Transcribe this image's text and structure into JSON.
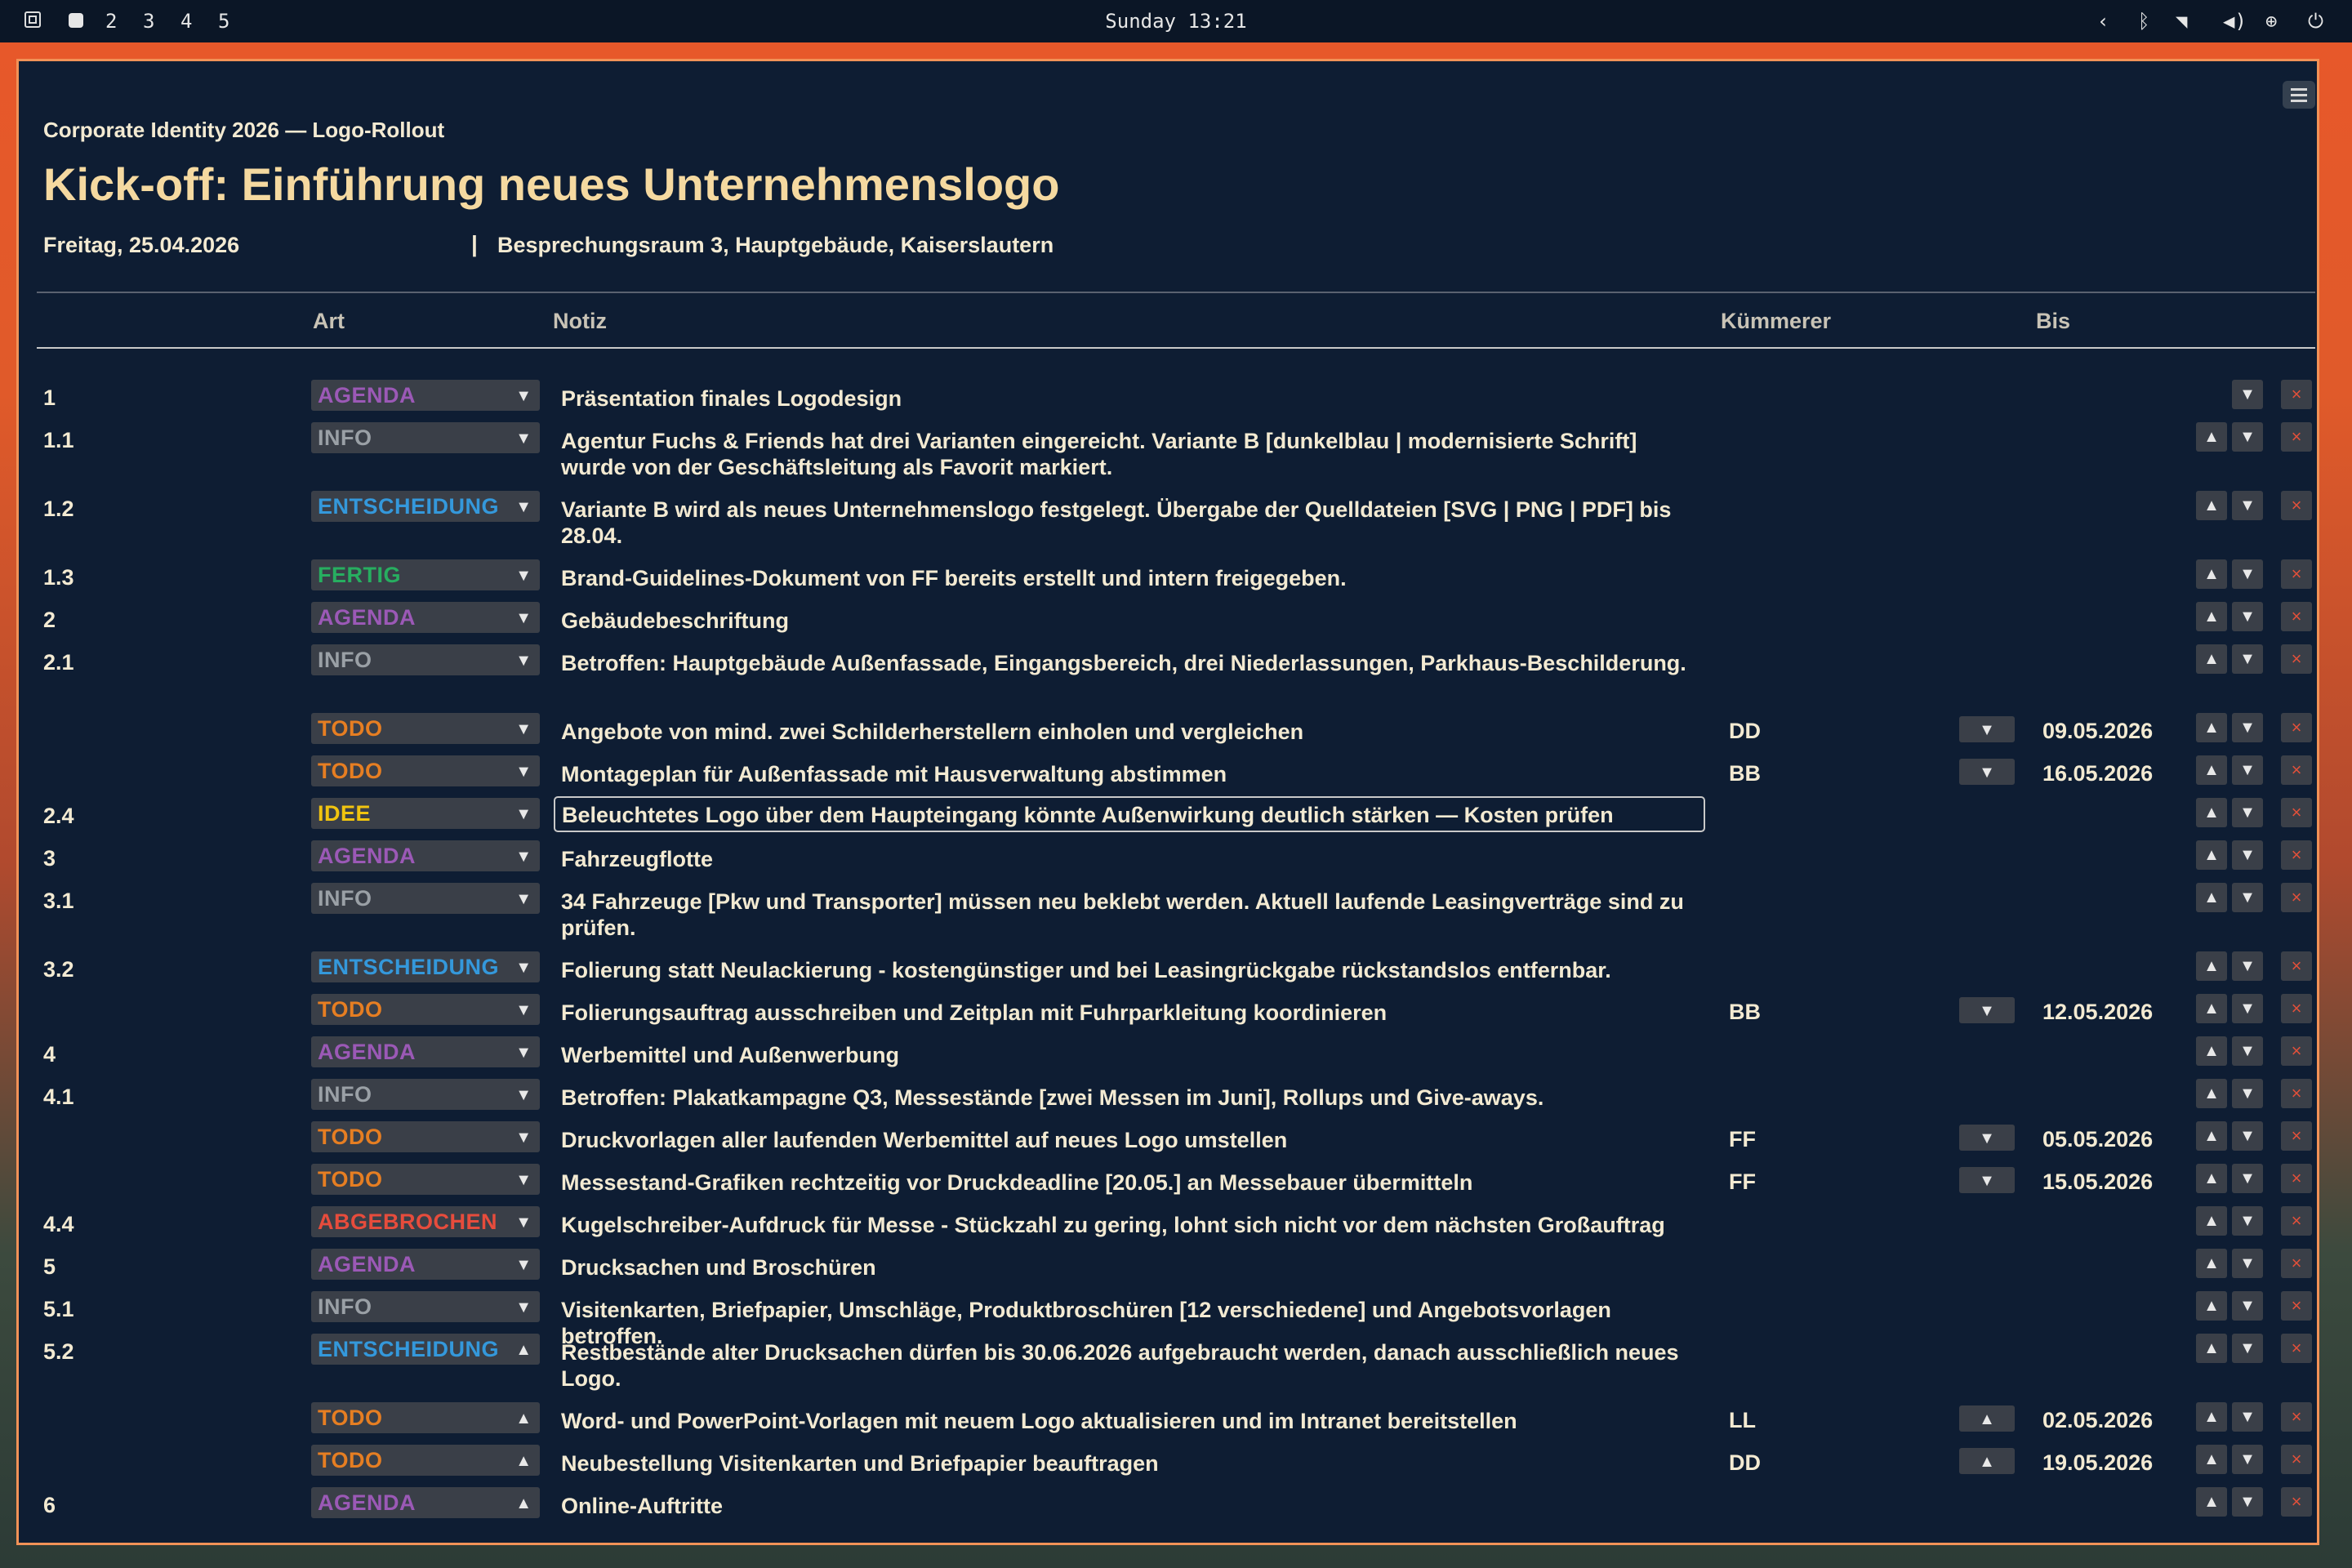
{
  "topbar": {
    "workspaces": [
      "2",
      "3",
      "4",
      "5"
    ],
    "clock": "Sunday 13:21"
  },
  "header": {
    "subtitle": "Corporate Identity 2026 — Logo-Rollout",
    "title": "Kick-off: Einführung neues Unternehmenslogo",
    "date": "Freitag, 25.04.2026",
    "separator": "|",
    "location": "Besprechungsraum 3, Hauptgebäude, Kaiserslautern"
  },
  "columns": {
    "art": "Art",
    "notiz": "Notiz",
    "kuemmerer": "Kümmerer",
    "bis": "Bis"
  },
  "colors": {
    "agenda": "#9b59b6",
    "info": "#9aa0a6",
    "entscheidung": "#3498db",
    "fertig": "#27ae60",
    "todo": "#e67e22",
    "idee": "#f1c40f",
    "abgebrochen": "#e74c3c",
    "window_border": "#f29257"
  },
  "rows": [
    {
      "num": "1",
      "type": "AGENDA",
      "note": "Präsentation finales Logodesign"
    },
    {
      "num": "1.1",
      "type": "INFO",
      "note": "Agentur Fuchs & Friends hat drei Varianten eingereicht. Variante B [dunkelblau | modernisierte Schrift] wurde von der Geschäftsleitung als Favorit markiert."
    },
    {
      "num": "1.2",
      "type": "ENTSCHEIDUNG",
      "note": "Variante B wird als neues Unternehmenslogo festgelegt. Übergabe der Quelldateien [SVG | PNG | PDF] bis 28.04."
    },
    {
      "num": "1.3",
      "type": "FERTIG",
      "note": "Brand-Guidelines-Dokument von FF bereits erstellt und intern freigegeben."
    },
    {
      "num": "2",
      "type": "AGENDA",
      "note": "Gebäudebeschriftung"
    },
    {
      "num": "2.1",
      "type": "INFO",
      "note": "Betroffen: Hauptgebäude Außenfassade, Eingangsbereich, drei Niederlassungen, Parkhaus-Beschilderung."
    },
    {
      "num": "",
      "type": "TODO",
      "note": "Angebote von mind. zwei Schilderherstellern einholen und vergleichen",
      "owner": "DD",
      "due": "09.05.2026"
    },
    {
      "num": "",
      "type": "TODO",
      "note": "Montageplan für Außenfassade mit Hausverwaltung abstimmen",
      "owner": "BB",
      "due": "16.05.2026"
    },
    {
      "num": "2.4",
      "type": "IDEE",
      "note": "Beleuchtetes Logo über dem Haupteingang könnte Außenwirkung deutlich stärken — Kosten prüfen"
    },
    {
      "num": "3",
      "type": "AGENDA",
      "note": "Fahrzeugflotte"
    },
    {
      "num": "3.1",
      "type": "INFO",
      "note": "34 Fahrzeuge [Pkw und Transporter] müssen neu beklebt werden. Aktuell laufende Leasingverträge sind zu prüfen."
    },
    {
      "num": "3.2",
      "type": "ENTSCHEIDUNG",
      "note": "Folierung statt Neulackierung - kostengünstiger und bei Leasingrückgabe rückstandslos entfernbar."
    },
    {
      "num": "",
      "type": "TODO",
      "note": "Folierungsauftrag ausschreiben und Zeitplan mit Fuhrparkleitung koordinieren",
      "owner": "BB",
      "due": "12.05.2026"
    },
    {
      "num": "4",
      "type": "AGENDA",
      "note": "Werbemittel und Außenwerbung"
    },
    {
      "num": "4.1",
      "type": "INFO",
      "note": "Betroffen: Plakatkampagne Q3, Messestände [zwei Messen im Juni], Rollups und Give-aways."
    },
    {
      "num": "",
      "type": "TODO",
      "note": "Druckvorlagen aller laufenden Werbemittel auf neues Logo umstellen",
      "owner": "FF",
      "due": "05.05.2026"
    },
    {
      "num": "",
      "type": "TODO",
      "note": "Messestand-Grafiken rechtzeitig vor Druckdeadline [20.05.] an Messebauer übermitteln",
      "owner": "FF",
      "due": "15.05.2026"
    },
    {
      "num": "4.4",
      "type": "ABGEBROCHEN",
      "note": "Kugelschreiber-Aufdruck für Messe - Stückzahl zu gering, lohnt sich nicht vor dem nächsten Großauftrag"
    },
    {
      "num": "5",
      "type": "AGENDA",
      "note": "Drucksachen und Broschüren"
    },
    {
      "num": "5.1",
      "type": "INFO",
      "note": "Visitenkarten, Briefpapier, Umschläge, Produktbroschüren [12 verschiedene] und Angebotsvorlagen betroffen."
    },
    {
      "num": "5.2",
      "type": "ENTSCHEIDUNG",
      "note": "Restbestände alter Drucksachen dürfen bis 30.06.2026 aufgebraucht werden, danach ausschließlich neues Logo."
    },
    {
      "num": "",
      "type": "TODO",
      "note": "Word- und PowerPoint-Vorlagen mit neuem Logo aktualisieren und im Intranet bereitstellen",
      "owner": "LL",
      "due": "02.05.2026"
    },
    {
      "num": "",
      "type": "TODO",
      "note": "Neubestellung Visitenkarten und Briefpapier beauftragen",
      "owner": "DD",
      "due": "19.05.2026"
    },
    {
      "num": "6",
      "type": "AGENDA",
      "note": "Online-Auftritte"
    }
  ]
}
